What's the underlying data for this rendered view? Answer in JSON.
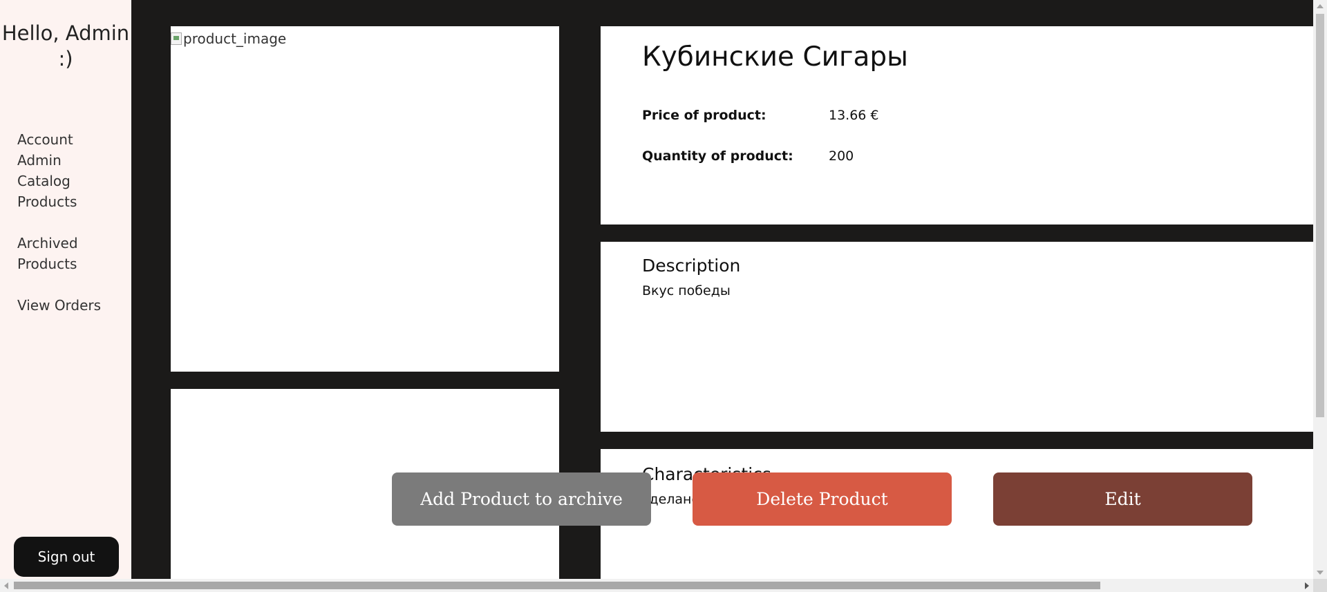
{
  "sidebar": {
    "greeting": "Hello, Admin :)",
    "nav": [
      {
        "label": "Account Admin"
      },
      {
        "label": "Catalog Products"
      },
      {
        "label": "Archived Products"
      },
      {
        "label": "View Orders"
      }
    ],
    "sign_out": "Sign out"
  },
  "product": {
    "image_alt": "product_image",
    "title": "Кубинские Сигары",
    "price_label": "Price of product:",
    "price_value": "13.66 €",
    "quantity_label": "Quantity of product:",
    "quantity_value": "200",
    "description_title": "Description",
    "description_text": "Вкус победы",
    "characteristics_title": "Characteristics",
    "characteristics_text": "сделано"
  },
  "actions": {
    "archive": "Add Product to archive",
    "delete": "Delete Product",
    "edit": "Edit"
  },
  "colors": {
    "archive_button": "#7b7b7b",
    "delete_button": "#d75a44",
    "edit_button": "#7b4035",
    "sidebar_bg": "#fdf3f1",
    "page_bg": "#1b1a19"
  }
}
